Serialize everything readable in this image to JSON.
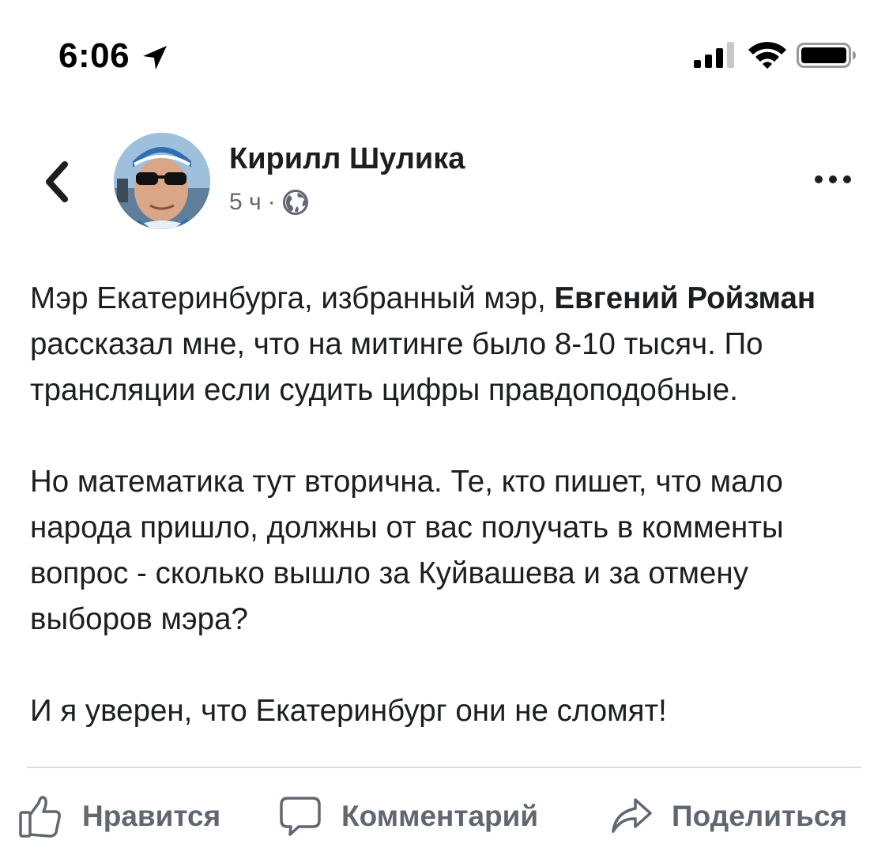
{
  "status_bar": {
    "time": "6:06"
  },
  "post": {
    "author": "Кирилл Шулика",
    "time_ago": "5 ч",
    "separator": "·",
    "privacy_icon": "globe-icon",
    "paragraph1": {
      "part1": "Мэр Екатеринбурга, избранный мэр, ",
      "bold": "Евгений Ройзман",
      "part2": " рассказал мне, что на митинге было 8-10 тысяч. По трансляции если судить цифры правдоподобные."
    },
    "paragraph2": "Но математика тут вторична. Те, кто пишет, что мало народа пришло, должны от вас получать в комменты вопрос - сколько вышло за Куйвашева и за отмену выборов мэра?",
    "paragraph3": "И я уверен, что Екатеринбург они не сломят!"
  },
  "actions": {
    "like": "Нравится",
    "comment": "Комментарий",
    "share": "Поделиться"
  },
  "colors": {
    "text": "#1c1e21",
    "secondary": "#606770",
    "divider": "#dadde1"
  }
}
